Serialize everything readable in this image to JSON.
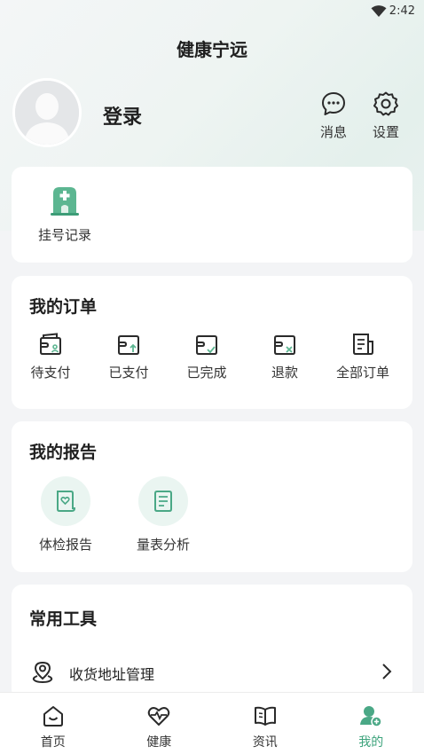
{
  "status_bar": {
    "time": "2:42"
  },
  "header": {
    "title": "健康宁远",
    "login_label": "登录",
    "messages_label": "消息",
    "settings_label": "设置"
  },
  "registration": {
    "item_label": "挂号记录"
  },
  "orders": {
    "title": "我的订单",
    "items": [
      {
        "label": "待支付",
        "icon": "wallet-person-icon"
      },
      {
        "label": "已支付",
        "icon": "wallet-up-icon"
      },
      {
        "label": "已完成",
        "icon": "wallet-check-icon"
      },
      {
        "label": "退款",
        "icon": "wallet-x-icon"
      },
      {
        "label": "全部订单",
        "icon": "document-list-icon"
      }
    ]
  },
  "reports": {
    "title": "我的报告",
    "items": [
      {
        "label": "体检报告",
        "icon": "checkup-report-icon"
      },
      {
        "label": "量表分析",
        "icon": "scale-analysis-icon"
      }
    ]
  },
  "tools": {
    "title": "常用工具",
    "items": [
      {
        "label": "收货地址管理",
        "icon": "location-pin-icon"
      }
    ]
  },
  "tabbar": {
    "items": [
      {
        "label": "首页",
        "icon": "home-icon"
      },
      {
        "label": "健康",
        "icon": "heart-pulse-icon"
      },
      {
        "label": "资讯",
        "icon": "book-icon"
      },
      {
        "label": "我的",
        "icon": "user-icon",
        "active": true
      }
    ]
  },
  "colors": {
    "accent": "#3da37c",
    "icon_green": "#5cb691",
    "text": "#1f1f1f"
  }
}
